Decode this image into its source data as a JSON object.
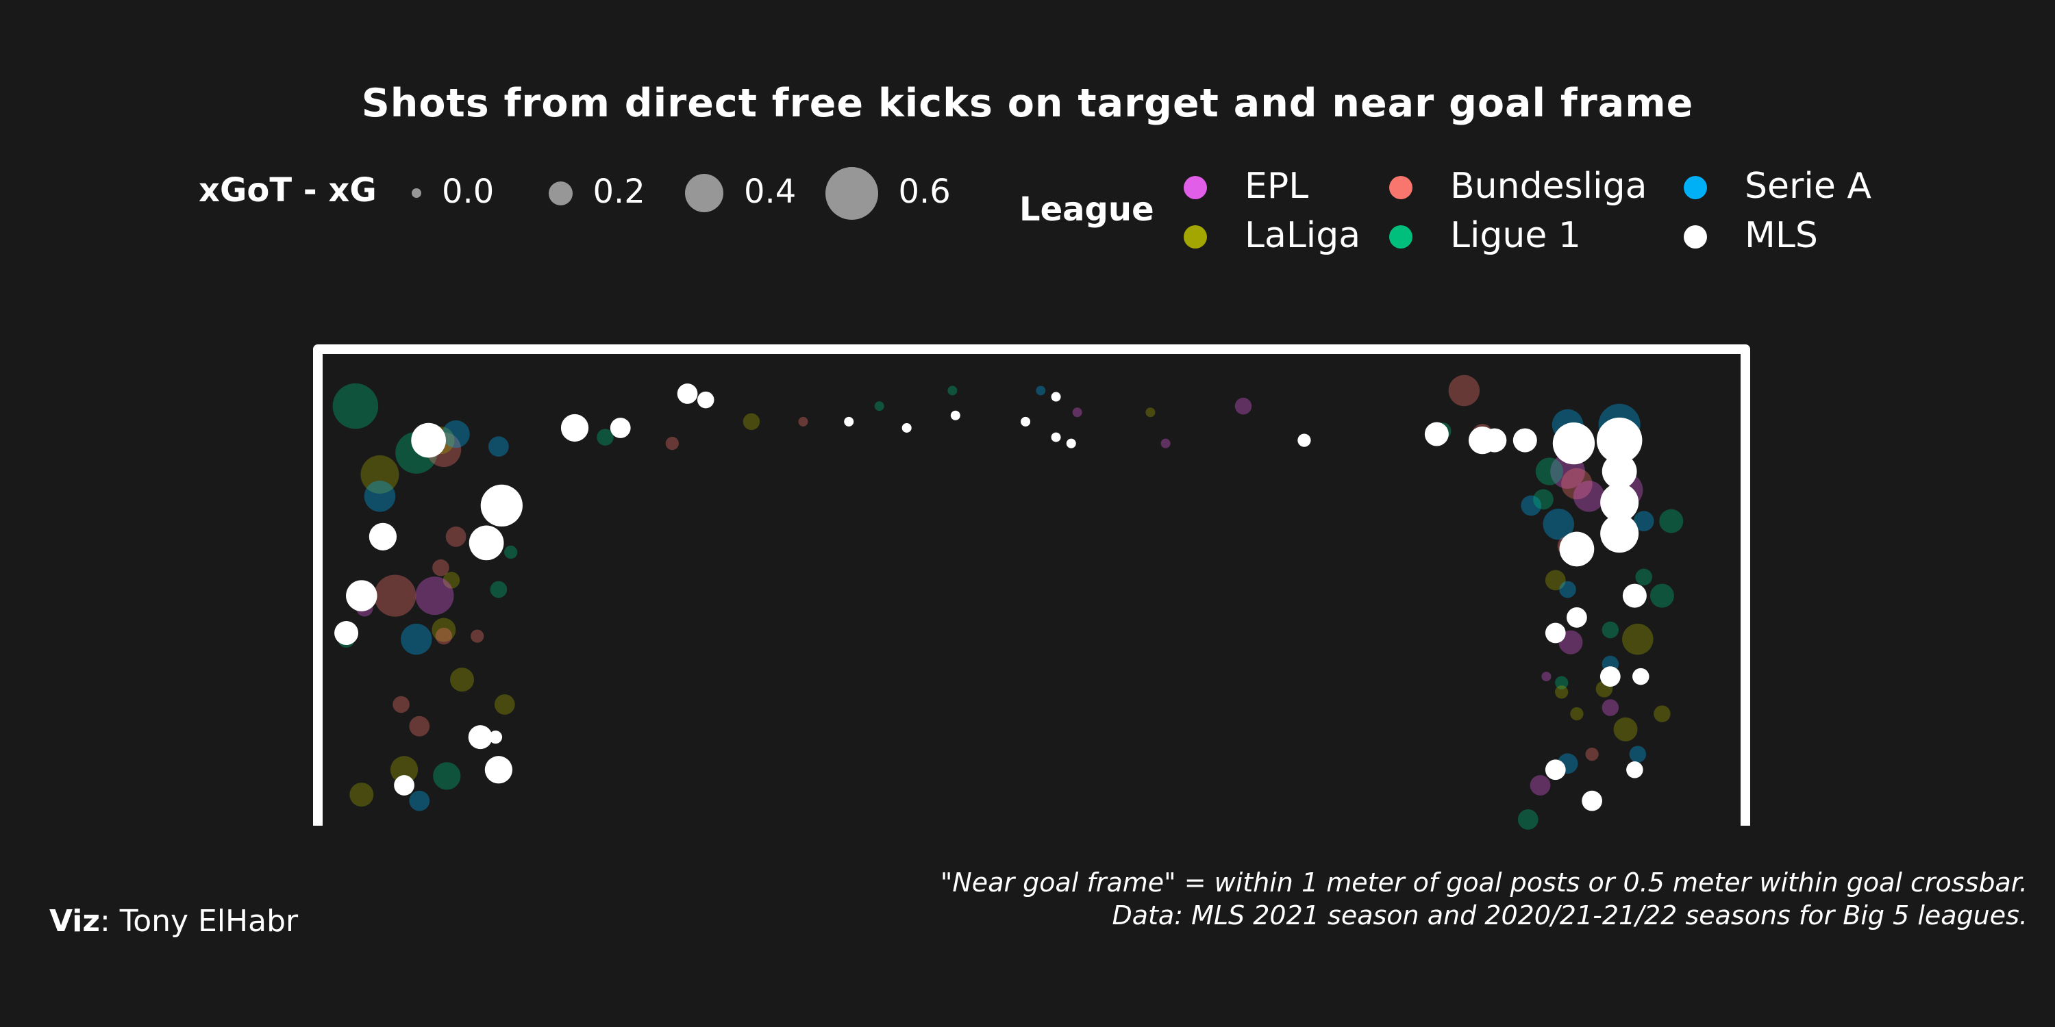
{
  "title": "Shots from direct free kicks on target and near goal frame",
  "size_legend": {
    "title": "xGoT - xG",
    "items": [
      {
        "label": "0.0",
        "value": 0.0
      },
      {
        "label": "0.2",
        "value": 0.2
      },
      {
        "label": "0.4",
        "value": 0.4
      },
      {
        "label": "0.6",
        "value": 0.6
      }
    ]
  },
  "color_legend": {
    "title": "League",
    "items": [
      {
        "label": "EPL",
        "color": "#e15ee8"
      },
      {
        "label": "Bundesliga",
        "color": "#f8766d"
      },
      {
        "label": "Serie A",
        "color": "#00b0f6"
      },
      {
        "label": "LaLiga",
        "color": "#a3a500"
      },
      {
        "label": "Ligue 1",
        "color": "#00bf7d"
      },
      {
        "label": "MLS",
        "color": "#ffffff"
      }
    ]
  },
  "caption_line1": "\"Near goal frame\" = within 1 meter of goal posts or 0.5 meter within goal crossbar.",
  "caption_line2": "Data: MLS 2021 season and 2020/21-21/22 seasons for Big 5 leagues.",
  "credit_label": "Viz",
  "credit_name": ": Tony ElHabr",
  "chart_data": {
    "type": "scatter",
    "xlim": [
      0,
      9.32
    ],
    "ylim": [
      0,
      3.04
    ],
    "size_variable": "xGoT - xG",
    "points": [
      {
        "league": "Ligue 1",
        "x": 0.22,
        "y": 2.7,
        "s": 0.5
      },
      {
        "league": "LaLiga",
        "x": 0.38,
        "y": 2.26,
        "s": 0.4
      },
      {
        "league": "Serie A",
        "x": 0.38,
        "y": 2.12,
        "s": 0.3
      },
      {
        "league": "Ligue 1",
        "x": 0.62,
        "y": 2.4,
        "s": 0.45
      },
      {
        "league": "Bundesliga",
        "x": 0.8,
        "y": 2.42,
        "s": 0.35
      },
      {
        "league": "LaLiga",
        "x": 0.78,
        "y": 2.48,
        "s": 0.25
      },
      {
        "league": "Serie A",
        "x": 0.88,
        "y": 2.52,
        "s": 0.25
      },
      {
        "league": "Serie A",
        "x": 1.16,
        "y": 2.44,
        "s": 0.15
      },
      {
        "league": "MLS",
        "x": 0.7,
        "y": 2.48,
        "s": 0.35
      },
      {
        "league": "MLS",
        "x": 1.18,
        "y": 2.06,
        "s": 0.45
      },
      {
        "league": "MLS",
        "x": 0.4,
        "y": 1.86,
        "s": 0.25
      },
      {
        "league": "MLS",
        "x": 1.08,
        "y": 1.82,
        "s": 0.35
      },
      {
        "league": "Bundesliga",
        "x": 0.88,
        "y": 1.86,
        "s": 0.15
      },
      {
        "league": "Ligue 1",
        "x": 1.24,
        "y": 1.76,
        "s": 0.05
      },
      {
        "league": "Bundesliga",
        "x": 0.78,
        "y": 1.66,
        "s": 0.1
      },
      {
        "league": "LaLiga",
        "x": 0.85,
        "y": 1.58,
        "s": 0.1
      },
      {
        "league": "Ligue 1",
        "x": 1.16,
        "y": 1.52,
        "s": 0.1
      },
      {
        "league": "Bundesliga",
        "x": 0.48,
        "y": 1.48,
        "s": 0.45
      },
      {
        "league": "EPL",
        "x": 0.74,
        "y": 1.48,
        "s": 0.4
      },
      {
        "league": "Ligue 1",
        "x": 0.26,
        "y": 1.5,
        "s": 0.1
      },
      {
        "league": "MLS",
        "x": 0.26,
        "y": 1.48,
        "s": 0.3
      },
      {
        "league": "EPL",
        "x": 0.28,
        "y": 1.4,
        "s": 0.1
      },
      {
        "league": "MLS",
        "x": 0.16,
        "y": 1.24,
        "s": 0.2
      },
      {
        "league": "Ligue 1",
        "x": 0.16,
        "y": 1.2,
        "s": 0.1
      },
      {
        "league": "Serie A",
        "x": 0.62,
        "y": 1.2,
        "s": 0.3
      },
      {
        "league": "LaLiga",
        "x": 0.8,
        "y": 1.26,
        "s": 0.2
      },
      {
        "league": "Bundesliga",
        "x": 0.8,
        "y": 1.22,
        "s": 0.1
      },
      {
        "league": "Bundesliga",
        "x": 1.02,
        "y": 1.22,
        "s": 0.05
      },
      {
        "league": "LaLiga",
        "x": 0.92,
        "y": 0.94,
        "s": 0.2
      },
      {
        "league": "LaLiga",
        "x": 1.2,
        "y": 0.78,
        "s": 0.15
      },
      {
        "league": "Bundesliga",
        "x": 0.52,
        "y": 0.78,
        "s": 0.1
      },
      {
        "league": "Bundesliga",
        "x": 0.64,
        "y": 0.64,
        "s": 0.15
      },
      {
        "league": "MLS",
        "x": 1.04,
        "y": 0.57,
        "s": 0.2
      },
      {
        "league": "MLS",
        "x": 1.14,
        "y": 0.57,
        "s": 0.05
      },
      {
        "league": "LaLiga",
        "x": 0.54,
        "y": 0.36,
        "s": 0.25
      },
      {
        "league": "Ligue 1",
        "x": 0.82,
        "y": 0.32,
        "s": 0.25
      },
      {
        "league": "MLS",
        "x": 1.16,
        "y": 0.36,
        "s": 0.25
      },
      {
        "league": "LaLiga",
        "x": 0.26,
        "y": 0.2,
        "s": 0.2
      },
      {
        "league": "MLS",
        "x": 0.54,
        "y": 0.26,
        "s": 0.15
      },
      {
        "league": "Serie A",
        "x": 0.64,
        "y": 0.16,
        "s": 0.15
      },
      {
        "league": "MLS",
        "x": 1.66,
        "y": 2.56,
        "s": 0.25
      },
      {
        "league": "Ligue 1",
        "x": 1.86,
        "y": 2.5,
        "s": 0.1
      },
      {
        "league": "MLS",
        "x": 1.96,
        "y": 2.56,
        "s": 0.15
      },
      {
        "league": "MLS",
        "x": 2.4,
        "y": 2.78,
        "s": 0.15
      },
      {
        "league": "MLS",
        "x": 2.52,
        "y": 2.74,
        "s": 0.1
      },
      {
        "league": "Bundesliga",
        "x": 2.3,
        "y": 2.46,
        "s": 0.05
      },
      {
        "league": "LaLiga",
        "x": 2.82,
        "y": 2.6,
        "s": 0.1
      },
      {
        "league": "Bundesliga",
        "x": 3.16,
        "y": 2.6,
        "s": 0.0
      },
      {
        "league": "MLS",
        "x": 3.46,
        "y": 2.6,
        "s": 0.0
      },
      {
        "league": "Ligue 1",
        "x": 3.66,
        "y": 2.7,
        "s": 0.0
      },
      {
        "league": "MLS",
        "x": 3.84,
        "y": 2.56,
        "s": 0.0
      },
      {
        "league": "Ligue 1",
        "x": 4.14,
        "y": 2.8,
        "s": 0.0
      },
      {
        "league": "MLS",
        "x": 4.16,
        "y": 2.64,
        "s": 0.0
      },
      {
        "league": "MLS",
        "x": 4.62,
        "y": 2.6,
        "s": 0.0
      },
      {
        "league": "Serie A",
        "x": 4.72,
        "y": 2.8,
        "s": 0.0
      },
      {
        "league": "MLS",
        "x": 4.82,
        "y": 2.76,
        "s": 0.0
      },
      {
        "league": "MLS",
        "x": 4.82,
        "y": 2.5,
        "s": 0.0
      },
      {
        "league": "EPL",
        "x": 4.96,
        "y": 2.66,
        "s": 0.0
      },
      {
        "league": "MLS",
        "x": 4.92,
        "y": 2.46,
        "s": 0.0
      },
      {
        "league": "LaLiga",
        "x": 5.44,
        "y": 2.66,
        "s": 0.0
      },
      {
        "league": "EPL",
        "x": 5.54,
        "y": 2.46,
        "s": 0.0
      },
      {
        "league": "EPL",
        "x": 6.05,
        "y": 2.7,
        "s": 0.1
      },
      {
        "league": "MLS",
        "x": 6.45,
        "y": 2.48,
        "s": 0.05
      },
      {
        "league": "Bundesliga",
        "x": 7.5,
        "y": 2.8,
        "s": 0.3
      },
      {
        "league": "Ligue 1",
        "x": 7.36,
        "y": 2.54,
        "s": 0.1
      },
      {
        "league": "MLS",
        "x": 7.32,
        "y": 2.52,
        "s": 0.2
      },
      {
        "league": "Bundesliga",
        "x": 7.62,
        "y": 2.52,
        "s": 0.15
      },
      {
        "league": "MLS",
        "x": 7.62,
        "y": 2.48,
        "s": 0.25
      },
      {
        "league": "MLS",
        "x": 7.7,
        "y": 2.48,
        "s": 0.2
      },
      {
        "league": "MLS",
        "x": 7.9,
        "y": 2.48,
        "s": 0.2
      },
      {
        "league": "Serie A",
        "x": 8.18,
        "y": 2.58,
        "s": 0.3
      },
      {
        "league": "Serie A",
        "x": 8.52,
        "y": 2.58,
        "s": 0.45
      },
      {
        "league": "MLS",
        "x": 8.22,
        "y": 2.46,
        "s": 0.45
      },
      {
        "league": "MLS",
        "x": 8.52,
        "y": 2.48,
        "s": 0.5
      },
      {
        "league": "EPL",
        "x": 8.18,
        "y": 2.28,
        "s": 0.35
      },
      {
        "league": "Ligue 1",
        "x": 8.06,
        "y": 2.28,
        "s": 0.25
      },
      {
        "league": "EPL",
        "x": 8.56,
        "y": 2.16,
        "s": 0.35
      },
      {
        "league": "MLS",
        "x": 8.52,
        "y": 2.28,
        "s": 0.35
      },
      {
        "league": "Bundesliga",
        "x": 8.24,
        "y": 2.2,
        "s": 0.3
      },
      {
        "league": "Serie A",
        "x": 7.94,
        "y": 2.06,
        "s": 0.15
      },
      {
        "league": "Ligue 1",
        "x": 8.02,
        "y": 2.1,
        "s": 0.15
      },
      {
        "league": "EPL",
        "x": 8.32,
        "y": 2.12,
        "s": 0.3
      },
      {
        "league": "MLS",
        "x": 8.52,
        "y": 2.08,
        "s": 0.4
      },
      {
        "league": "Serie A",
        "x": 8.12,
        "y": 1.94,
        "s": 0.3
      },
      {
        "league": "Serie A",
        "x": 8.68,
        "y": 1.96,
        "s": 0.15
      },
      {
        "league": "Ligue 1",
        "x": 8.86,
        "y": 1.96,
        "s": 0.2
      },
      {
        "league": "MLS",
        "x": 8.52,
        "y": 1.88,
        "s": 0.4
      },
      {
        "league": "Bundesliga",
        "x": 8.18,
        "y": 1.8,
        "s": 0.15
      },
      {
        "league": "MLS",
        "x": 8.24,
        "y": 1.78,
        "s": 0.35
      },
      {
        "league": "LaLiga",
        "x": 8.1,
        "y": 1.58,
        "s": 0.15
      },
      {
        "league": "Serie A",
        "x": 8.18,
        "y": 1.52,
        "s": 0.1
      },
      {
        "league": "Ligue 1",
        "x": 8.68,
        "y": 1.6,
        "s": 0.1
      },
      {
        "league": "MLS",
        "x": 8.62,
        "y": 1.48,
        "s": 0.2
      },
      {
        "league": "Ligue 1",
        "x": 8.8,
        "y": 1.48,
        "s": 0.2
      },
      {
        "league": "MLS",
        "x": 8.24,
        "y": 1.34,
        "s": 0.15
      },
      {
        "league": "MLS",
        "x": 8.1,
        "y": 1.24,
        "s": 0.15
      },
      {
        "league": "EPL",
        "x": 8.2,
        "y": 1.18,
        "s": 0.2
      },
      {
        "league": "Ligue 1",
        "x": 8.46,
        "y": 1.26,
        "s": 0.1
      },
      {
        "league": "LaLiga",
        "x": 8.64,
        "y": 1.2,
        "s": 0.3
      },
      {
        "league": "Serie A",
        "x": 8.46,
        "y": 1.04,
        "s": 0.1
      },
      {
        "league": "EPL",
        "x": 8.04,
        "y": 0.96,
        "s": 0.0
      },
      {
        "league": "Ligue 1",
        "x": 8.14,
        "y": 0.92,
        "s": 0.05
      },
      {
        "league": "LaLiga",
        "x": 8.14,
        "y": 0.86,
        "s": 0.05
      },
      {
        "league": "MLS",
        "x": 8.46,
        "y": 0.96,
        "s": 0.15
      },
      {
        "league": "MLS",
        "x": 8.66,
        "y": 0.96,
        "s": 0.1
      },
      {
        "league": "LaLiga",
        "x": 8.42,
        "y": 0.88,
        "s": 0.1
      },
      {
        "league": "EPL",
        "x": 8.46,
        "y": 0.76,
        "s": 0.1
      },
      {
        "league": "LaLiga",
        "x": 8.24,
        "y": 0.72,
        "s": 0.05
      },
      {
        "league": "LaLiga",
        "x": 8.56,
        "y": 0.62,
        "s": 0.2
      },
      {
        "league": "LaLiga",
        "x": 8.8,
        "y": 0.72,
        "s": 0.1
      },
      {
        "league": "Bundesliga",
        "x": 8.34,
        "y": 0.46,
        "s": 0.05
      },
      {
        "league": "Serie A",
        "x": 8.64,
        "y": 0.46,
        "s": 0.1
      },
      {
        "league": "Serie A",
        "x": 8.18,
        "y": 0.4,
        "s": 0.15
      },
      {
        "league": "MLS",
        "x": 8.1,
        "y": 0.36,
        "s": 0.15
      },
      {
        "league": "MLS",
        "x": 8.62,
        "y": 0.36,
        "s": 0.1
      },
      {
        "league": "EPL",
        "x": 8.0,
        "y": 0.26,
        "s": 0.15
      },
      {
        "league": "MLS",
        "x": 8.34,
        "y": 0.16,
        "s": 0.15
      },
      {
        "league": "Ligue 1",
        "x": 7.92,
        "y": 0.04,
        "s": 0.15
      }
    ]
  }
}
